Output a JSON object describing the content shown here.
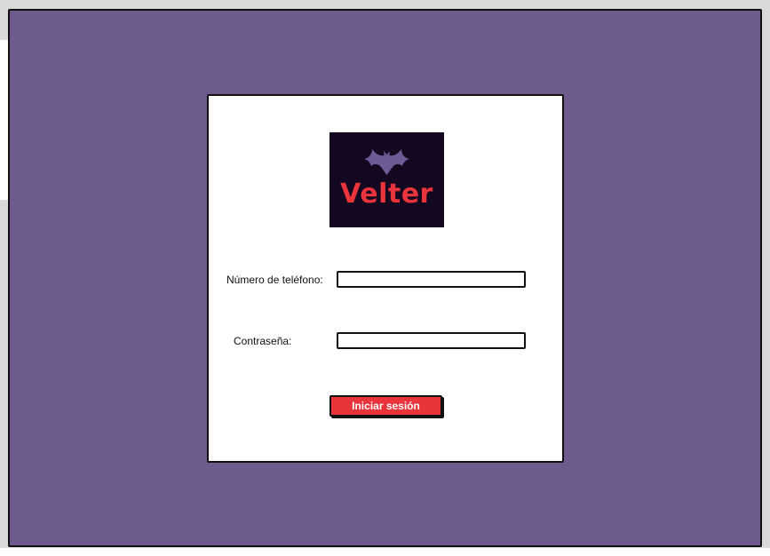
{
  "logo": {
    "text": "Velter",
    "icon": "bat-icon",
    "bg_color": "#140820",
    "text_color": "#e8343a"
  },
  "form": {
    "phone_label": "Número de teléfono:",
    "phone_value": "",
    "password_label": "Contraseña:",
    "password_value": "",
    "submit_label": "Iniciar sesión"
  },
  "colors": {
    "background": "#6c5b8c",
    "card": "#ffffff",
    "accent": "#e8343a"
  }
}
